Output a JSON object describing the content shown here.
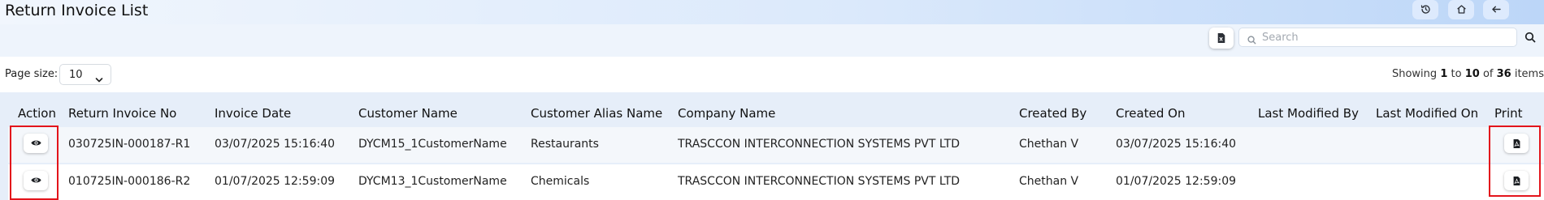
{
  "page": {
    "title": "Return Invoice List"
  },
  "top_actions": [
    {
      "name": "history-button",
      "icon": "history-icon"
    },
    {
      "name": "home-button",
      "icon": "home-icon"
    },
    {
      "name": "back-button",
      "icon": "arrow-left-icon"
    }
  ],
  "toolbar": {
    "export_icon": "excel-file-icon",
    "search_placeholder": "Search",
    "search_value": "",
    "search_icon": "search-icon"
  },
  "pagination": {
    "page_size_label": "Page size:",
    "page_size": "10",
    "showing_prefix": "Showing",
    "from": "1",
    "to_word": "to",
    "to": "10",
    "of_word": "of",
    "total": "36",
    "suffix": "items"
  },
  "table": {
    "columns": [
      "Action",
      "Return Invoice No",
      "Invoice Date",
      "Customer Name",
      "Customer Alias Name",
      "Company Name",
      "Created By",
      "Created On",
      "Last Modified By",
      "Last Modified On",
      "Print"
    ],
    "rows": [
      {
        "return_invoice_no": "030725IN-000187-R1",
        "invoice_date": "03/07/2025 15:16:40",
        "customer_name": "DYCM15_1CustomerName",
        "customer_alias": "Restaurants",
        "company_name": "TRASCCON INTERCONNECTION SYSTEMS PVT LTD",
        "created_by": "Chethan V",
        "created_on": "03/07/2025 15:16:40",
        "last_modified_by": "",
        "last_modified_on": ""
      },
      {
        "return_invoice_no": "010725IN-000186-R2",
        "invoice_date": "01/07/2025 12:59:09",
        "customer_name": "DYCM13_1CustomerName",
        "customer_alias": "Chemicals",
        "company_name": "TRASCCON INTERCONNECTION SYSTEMS PVT LTD",
        "created_by": "Chethan V",
        "created_on": "01/07/2025 12:59:09",
        "last_modified_by": "",
        "last_modified_on": ""
      }
    ],
    "action_icon": "eye-icon",
    "print_icon": "pdf-icon"
  },
  "colors": {
    "highlight_border": "#e3141b",
    "header_gradient_end": "#bcd6f8",
    "table_header_bg": "#e6eef9"
  }
}
